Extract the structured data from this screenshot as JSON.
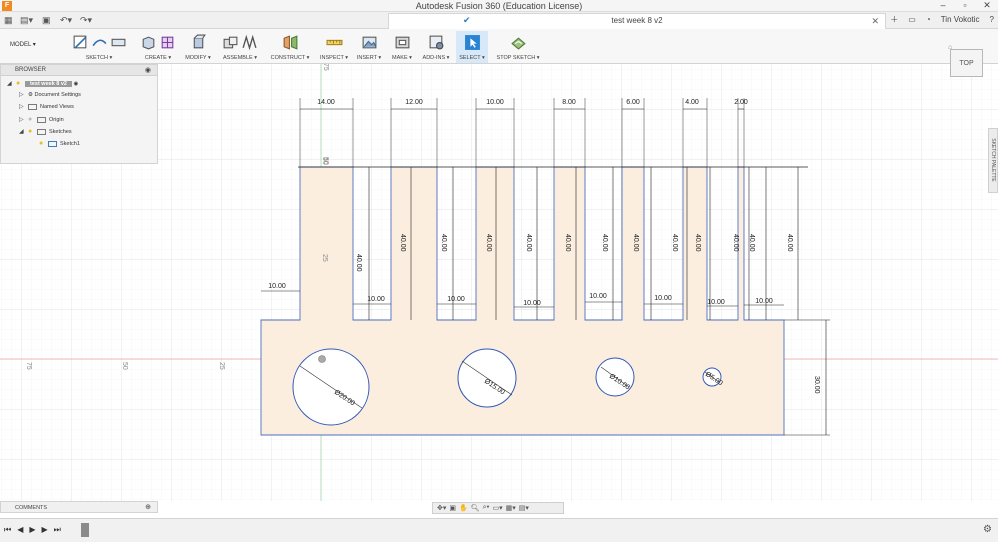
{
  "window": {
    "app_icon": "F",
    "title": "Autodesk Fusion 360 (Education License)",
    "controls": [
      "–",
      "▫",
      "✕"
    ]
  },
  "qat": {
    "doc_tab_title": "test week 8 v2",
    "user_name": "Tin Vokotic"
  },
  "toolbar": {
    "mode_label": "MODEL ▾",
    "groups": [
      {
        "label": "SKETCH ▾"
      },
      {
        "label": "CREATE ▾"
      },
      {
        "label": "MODIFY ▾"
      },
      {
        "label": "ASSEMBLE ▾"
      },
      {
        "label": "CONSTRUCT ▾"
      },
      {
        "label": "INSPECT ▾"
      },
      {
        "label": "INSERT ▾"
      },
      {
        "label": "MAKE ▾"
      },
      {
        "label": "ADD-INS ▾"
      },
      {
        "label": "SELECT ▾"
      },
      {
        "label": "STOP SKETCH ▾"
      }
    ]
  },
  "browser": {
    "title": "BROWSER",
    "items": [
      {
        "label": "test week 8 v2"
      },
      {
        "label": "Document Settings"
      },
      {
        "label": "Named Views"
      },
      {
        "label": "Origin"
      },
      {
        "label": "Sketches"
      },
      {
        "label": "Sketch1"
      }
    ]
  },
  "viewcube": {
    "label": "TOP"
  },
  "sketch_palette": {
    "label": "SKETCH PALETTE"
  },
  "comments": {
    "title": "COMMENTS"
  },
  "axis_labels": {
    "x_negative": [
      "75",
      "50",
      "25"
    ],
    "y_positive": [
      "75",
      "50",
      "25"
    ]
  },
  "dimensions": {
    "top_widths": [
      "14.00",
      "12.00",
      "10.00",
      "8.00",
      "6.00",
      "4.00",
      "2.00"
    ],
    "heights_40": [
      "40.00",
      "40.00",
      "40.00",
      "40.00",
      "40.00",
      "40.00",
      "40.00",
      "40.00",
      "40.00",
      "40.00",
      "40.00",
      "40.00",
      "40.00"
    ],
    "gaps": [
      "10.00",
      "10.00",
      "10.00",
      "10.00",
      "10.00",
      "10.00",
      "10.00"
    ],
    "left_step": "10.00",
    "base_height": "30.00",
    "holes": [
      "Ø20.00",
      "Ø15.00",
      "Ø10.00",
      "Ø5.00"
    ]
  }
}
